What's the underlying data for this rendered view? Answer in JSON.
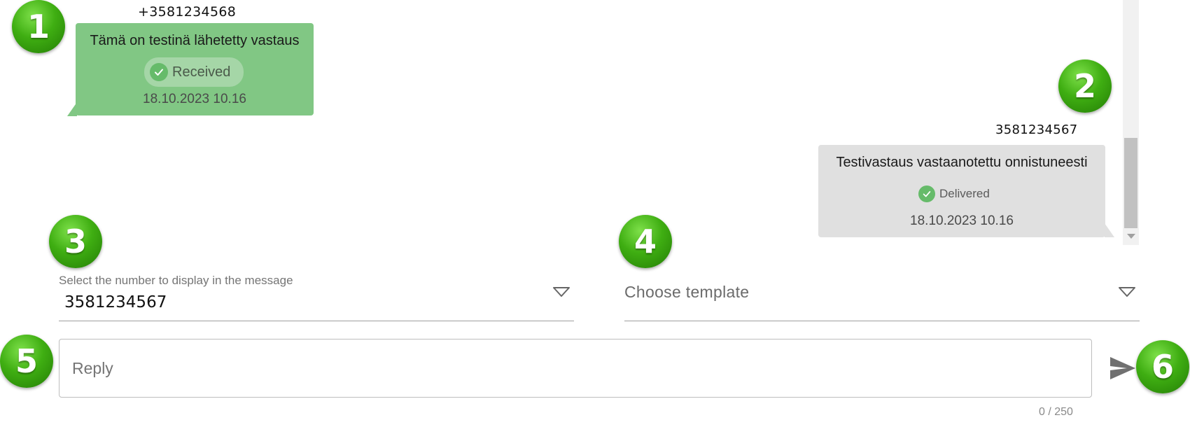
{
  "messages": [
    {
      "sender": "+3581234568",
      "text": "Tämä on testinä lähetetty vastaus",
      "status": "Received",
      "timestamp": "18.10.2023 10.16"
    },
    {
      "sender": "3581234567",
      "text": "Testivastaus vastaanotettu onnistuneesti",
      "status": "Delivered",
      "timestamp": "18.10.2023 10.16"
    }
  ],
  "number_select": {
    "label": "Select the number to display in the message",
    "value": "3581234567"
  },
  "template_select": {
    "placeholder": "Choose template"
  },
  "reply": {
    "placeholder": "Reply",
    "counter": "0 / 250"
  },
  "badges": [
    "1",
    "2",
    "3",
    "4",
    "5",
    "6"
  ],
  "colors": {
    "incoming_bubble": "#81c784",
    "outgoing_bubble": "#e0e0e0",
    "status_check": "#66bb6a",
    "badge_green": "#3fae12"
  },
  "icons": {
    "check": "check-circle-icon",
    "dropdown": "triangle-down-icon",
    "send": "send-icon"
  }
}
